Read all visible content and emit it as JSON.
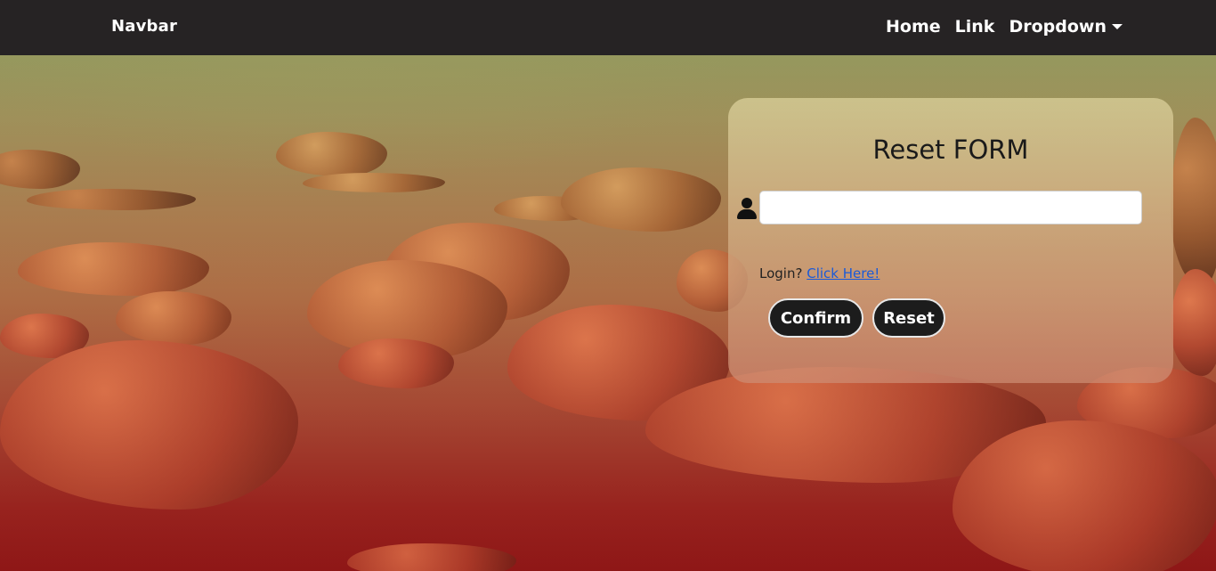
{
  "navbar": {
    "brand": "Navbar",
    "links": [
      {
        "label": "Home"
      },
      {
        "label": "Link"
      },
      {
        "label": "Dropdown"
      }
    ]
  },
  "form": {
    "title": "Reset FORM",
    "input": {
      "value": "",
      "placeholder": "",
      "icon": "user-icon"
    },
    "login_prompt": "Login?",
    "login_link": "Click Here!",
    "confirm_label": "Confirm",
    "reset_label": "Reset"
  },
  "colors": {
    "navbar_bg": "#262324",
    "button_bg": "#1c1c1c",
    "link": "#1a5ad8"
  }
}
